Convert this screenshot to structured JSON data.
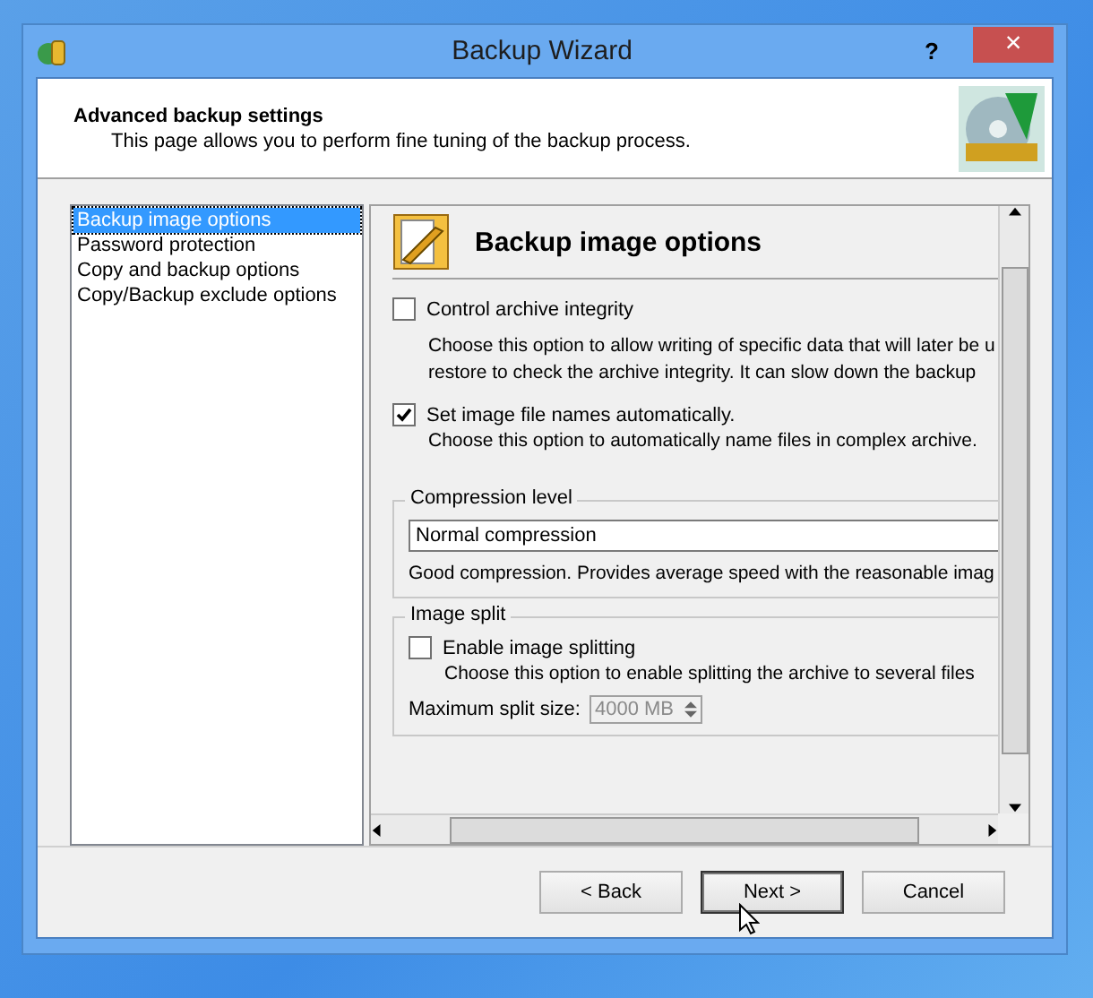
{
  "window": {
    "title": "Backup Wizard",
    "help": "?",
    "close": "×"
  },
  "header": {
    "title": "Advanced backup settings",
    "subtitle": "This page allows you to perform fine tuning of the backup process."
  },
  "sidebar": {
    "items": [
      {
        "label": "Backup image options",
        "selected": true
      },
      {
        "label": "Password protection",
        "selected": false
      },
      {
        "label": "Copy and backup options",
        "selected": false
      },
      {
        "label": "Copy/Backup exclude options",
        "selected": false
      }
    ]
  },
  "panel": {
    "title": "Backup image options",
    "options": [
      {
        "label": "Control archive integrity",
        "checked": false,
        "description": [
          "Choose this option to allow writing of specific data that will later be u",
          "restore to check the archive integrity. It can slow down the backup"
        ]
      },
      {
        "label": "Set image file names automatically.",
        "checked": true,
        "description": [
          "Choose this option to automatically name files in complex archive."
        ]
      }
    ],
    "compression": {
      "legend": "Compression level",
      "value": "Normal compression",
      "description": "Good compression. Provides average speed with the reasonable imag"
    },
    "split": {
      "legend": "Image split",
      "checkbox": {
        "label": "Enable image splitting",
        "checked": false,
        "description": "Choose this option to enable splitting the archive to several files"
      },
      "size_label": "Maximum split size:",
      "size_value": "4000 MB",
      "disabled": true
    }
  },
  "buttons": [
    {
      "label": "< Back",
      "focused": false
    },
    {
      "label": "Next >",
      "focused": true
    },
    {
      "label": "Cancel",
      "focused": false
    }
  ]
}
